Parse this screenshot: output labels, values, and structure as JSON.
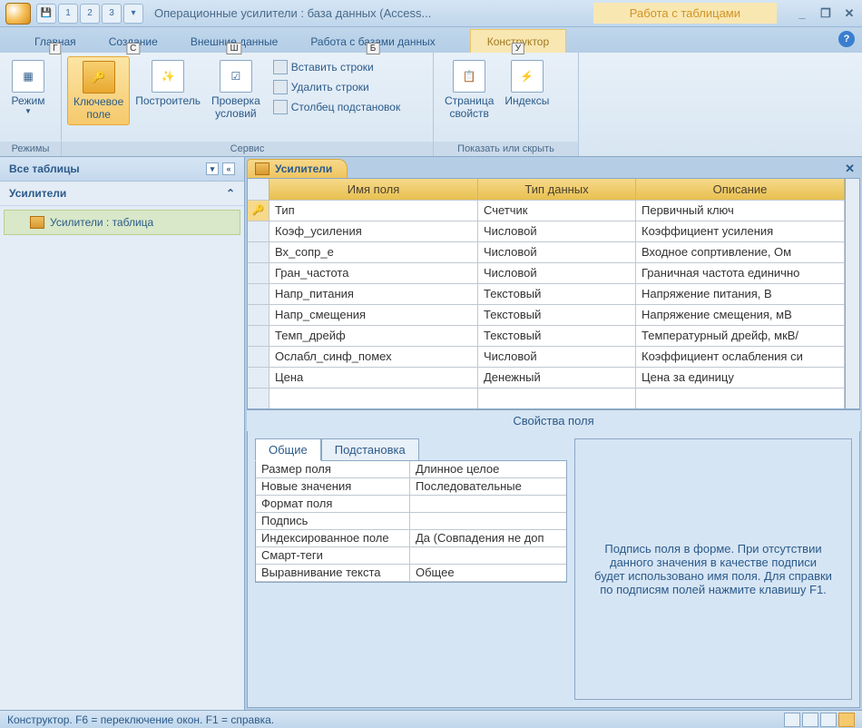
{
  "title": "Операционные усилители : база данных (Access...",
  "context_tab_group": "Работа с таблицами",
  "window_controls": {
    "min": "_",
    "restore": "❐",
    "close": "✕"
  },
  "ribbon": {
    "tabs": [
      {
        "label": "Главная",
        "keytip": "Г"
      },
      {
        "label": "Создание",
        "keytip": "С"
      },
      {
        "label": "Внешние данные",
        "keytip": "Ш"
      },
      {
        "label": "Работа с базами данных",
        "keytip": "Б"
      },
      {
        "label": "Конструктор",
        "keytip": "У",
        "context": true
      }
    ],
    "groups": {
      "modes": {
        "label": "Режимы",
        "buttons": {
          "view": "Режим"
        }
      },
      "service": {
        "label": "Сервис",
        "buttons": {
          "primary_key": "Ключевое\nполе",
          "builder": "Построитель",
          "test_rules": "Проверка\nусловий",
          "insert_rows": "Вставить строки",
          "delete_rows": "Удалить строки",
          "lookup_col": "Столбец  подстановок"
        }
      },
      "show_hide": {
        "label": "Показать или скрыть",
        "buttons": {
          "prop_sheet": "Страница\nсвойств",
          "indexes": "Индексы"
        }
      }
    }
  },
  "nav": {
    "header": "Все таблицы",
    "group": "Усилители",
    "item": "Усилители : таблица"
  },
  "doc_tab": "Усилители",
  "doc_close": "✕",
  "design_columns": {
    "name": "Имя поля",
    "type": "Тип данных",
    "desc": "Описание"
  },
  "fields": [
    {
      "name": "Тип",
      "type": "Счетчик",
      "desc": "Первичный ключ",
      "pk": true
    },
    {
      "name": "Коэф_усиления",
      "type": "Числовой",
      "desc": "Коэффициент усиления"
    },
    {
      "name": "Вх_сопр_е",
      "type": "Числовой",
      "desc": "Входное сопртивление, Ом"
    },
    {
      "name": "Гран_частота",
      "type": "Числовой",
      "desc": "Граничная частота единично"
    },
    {
      "name": "Напр_питания",
      "type": "Текстовый",
      "desc": "Напряжение питания,  В"
    },
    {
      "name": "Напр_смещения",
      "type": "Текстовый",
      "desc": "Напряжение смещения, мВ"
    },
    {
      "name": "Темп_дрейф",
      "type": "Текстовый",
      "desc": "Температурный дрейф, мкВ/"
    },
    {
      "name": "Ослабл_синф_помех",
      "type": "Числовой",
      "desc": "Коэффициент ослабления си"
    },
    {
      "name": "Цена",
      "type": "Денежный",
      "desc": "Цена за единицу"
    }
  ],
  "splitter_label": "Свойства поля",
  "props_tabs": {
    "general": "Общие",
    "lookup": "Подстановка"
  },
  "props": [
    {
      "n": "Размер поля",
      "v": "Длинное целое"
    },
    {
      "n": "Новые значения",
      "v": "Последовательные"
    },
    {
      "n": "Формат поля",
      "v": ""
    },
    {
      "n": "Подпись",
      "v": ""
    },
    {
      "n": "Индексированное поле",
      "v": "Да (Совпадения не доп"
    },
    {
      "n": "Смарт-теги",
      "v": ""
    },
    {
      "n": "Выравнивание текста",
      "v": "Общее"
    }
  ],
  "props_help": "Подпись поля в форме.  При отсутствии данного значения в качестве подписи будет использовано имя поля.  Для справки по подписям полей нажмите клавишу F1.",
  "status": "Конструктор.  F6 = переключение окон.  F1 = справка."
}
